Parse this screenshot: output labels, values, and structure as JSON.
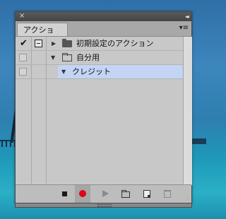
{
  "panel": {
    "title_close_glyph": "×",
    "title_collapse_glyph": "◂◂",
    "tab_label": "アクション",
    "menu_glyph": "▾≡"
  },
  "actions": [
    {
      "checked": "✔",
      "expand": "▶",
      "folder": "closed",
      "label": "初期設定のアクション",
      "dialog_toggle": "active"
    },
    {
      "checked": "",
      "expand": "▼",
      "folder": "open",
      "label": "自分用",
      "dialog_toggle": "off"
    },
    {
      "checked": "",
      "expand": "▼",
      "folder": "none",
      "label": "クレジット",
      "dialog_toggle": "off",
      "selected": true
    }
  ],
  "footer": {
    "buttons": [
      "stop-icon",
      "record-icon",
      "play-icon",
      "new-set-icon",
      "new-action-icon",
      "delete-icon"
    ],
    "record_color": "#e0001a",
    "grip_glyph": "⋰"
  },
  "colors": {
    "panel_bg": "#c8c8c8",
    "selection": "#c3d4f5",
    "titlebar": "#4f4f4f"
  }
}
